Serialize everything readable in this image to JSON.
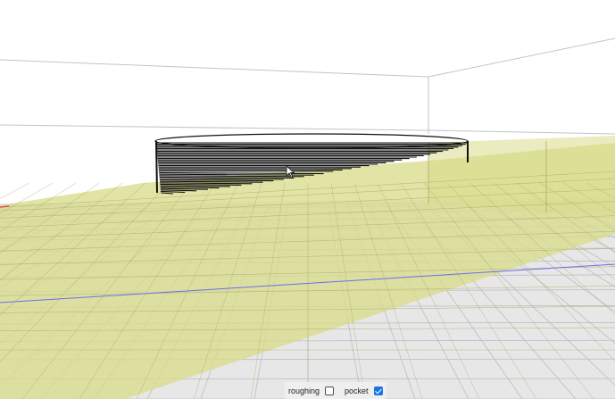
{
  "viewport": {
    "colors": {
      "background": "#ffffff",
      "floor_tile": "#e7e7e7",
      "floor_line": "#bdbdbd",
      "stock_fill": "#d9dd8c",
      "stock_line": "#aaa966",
      "toolpath": "#111111",
      "axis_blue": "#6c6cf0",
      "axis_red": "#e05050"
    },
    "cursor_icon": "mouse-pointer-arrow"
  },
  "controls": {
    "options": [
      {
        "label": "roughing",
        "checked": false
      },
      {
        "label": "pocket",
        "checked": true
      }
    ],
    "accent_color": "#1a73e8"
  }
}
